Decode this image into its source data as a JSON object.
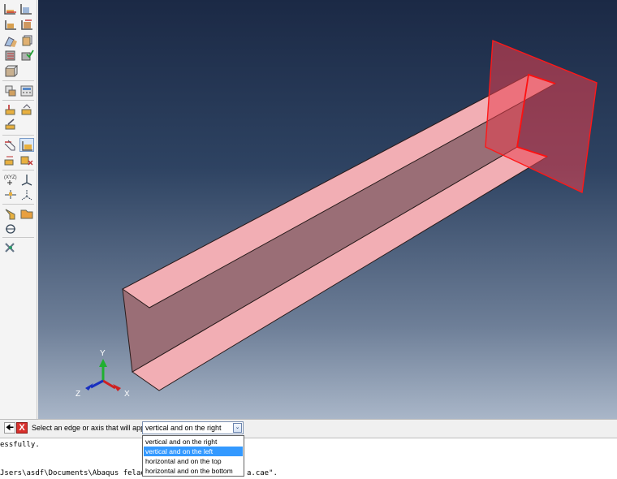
{
  "prompt": {
    "text": "Select an edge or axis that will appear",
    "combo_value": "vertical and on the right",
    "options": [
      "vertical and on the right",
      "vertical and on the left",
      "horizontal and on the top",
      "horizontal and on the bottom"
    ],
    "selected_index": 1
  },
  "message_area": {
    "line1": "essfully.",
    "line2": "Jsers\\asdf\\Documents\\Abaqus felad",
    "line2_tail": "a.cae\"."
  },
  "triad": {
    "y": "Y",
    "x": "X",
    "z": "Z"
  },
  "colors": {
    "part_face": "#f2aeb4",
    "part_web": "#9a6e76",
    "edge": "#2a1c1c",
    "sketch_plane": "#e8404e",
    "selected_edge": "#ff1010",
    "axis_x": "#d02020",
    "axis_y": "#20b030",
    "axis_z": "#1830c0",
    "dropdown_highlight": "#3399ff"
  }
}
